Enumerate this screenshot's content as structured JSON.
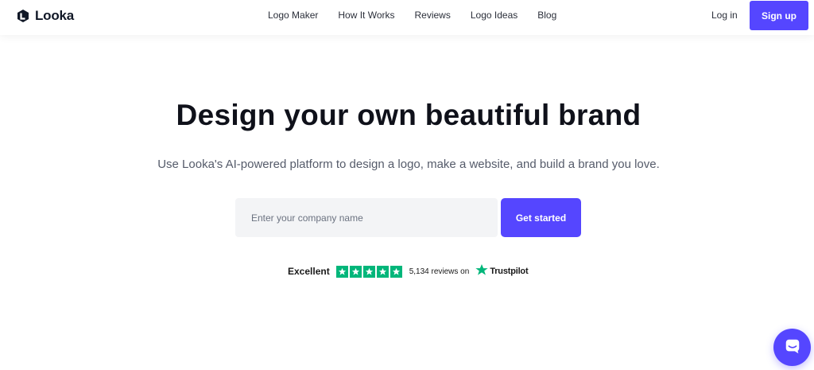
{
  "header": {
    "brand": "Looka",
    "nav": [
      {
        "label": "Logo Maker"
      },
      {
        "label": "How It Works"
      },
      {
        "label": "Reviews"
      },
      {
        "label": "Logo Ideas"
      },
      {
        "label": "Blog"
      }
    ],
    "login_label": "Log in",
    "signup_label": "Sign up"
  },
  "hero": {
    "title": "Design your own beautiful brand",
    "subtitle": "Use Looka's AI-powered platform to design a logo, make a website, and build a brand you love."
  },
  "form": {
    "company_placeholder": "Enter your company name",
    "company_value": "",
    "submit_label": "Get started"
  },
  "trust": {
    "rating_label": "Excellent",
    "stars": 5,
    "reviews_text": "5,134 reviews on",
    "provider": "Trustpilot"
  },
  "icons": {
    "brand_icon": "looka-logo-icon",
    "star_icon": "star-icon",
    "trustpilot_icon": "trustpilot-star-icon",
    "chat_icon": "chat-icon"
  },
  "colors": {
    "accent": "#5546ff",
    "trustpilot_green": "#00b67a",
    "input_bg": "#f3f4f6",
    "heading": "#0f111a",
    "subtitle": "#555b6a"
  }
}
